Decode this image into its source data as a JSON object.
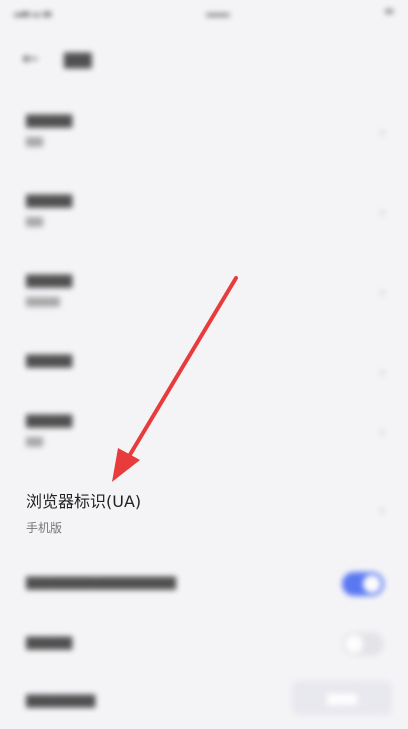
{
  "ua_item": {
    "title": "浏览器标识(UA)",
    "value": "手机版"
  },
  "annotation": {
    "arrow_color": "#e83c3c"
  },
  "accent_color": "#3f63f0",
  "watermark_icon": "baidu-jingyan-logo"
}
